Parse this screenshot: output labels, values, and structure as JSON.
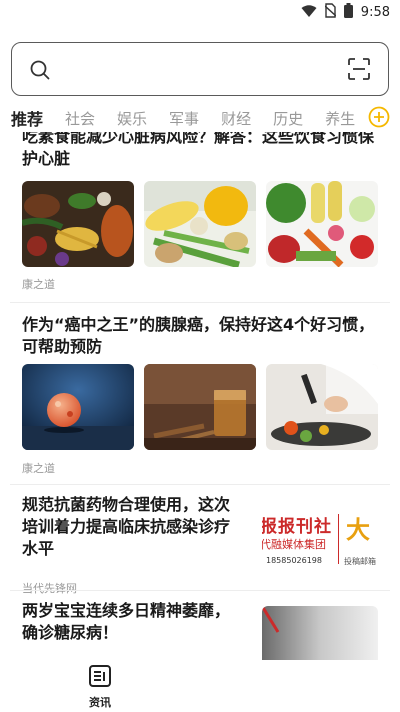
{
  "status_bar": {
    "time": "9:58",
    "icons": [
      "wifi-icon",
      "no-sim-icon",
      "battery-icon"
    ]
  },
  "search": {
    "placeholder": "",
    "search_icon": "search-icon",
    "scan_icon": "scan-icon"
  },
  "tabs": [
    {
      "label": "推荐",
      "active": true
    },
    {
      "label": "社会"
    },
    {
      "label": "娱乐"
    },
    {
      "label": "军事"
    },
    {
      "label": "财经"
    },
    {
      "label": "历史"
    },
    {
      "label": "养生"
    }
  ],
  "add_tab_icon": "plus-circle-icon",
  "accent_color": "#f5b800",
  "feed": {
    "articles": [
      {
        "title": "吃素食能减少心脏病风险？解答：这些饮食习惯保护心脏",
        "source": "康之道",
        "images": [
          "vegetables-table-image",
          "vegetables-corn-image",
          "vegetables-crate-image"
        ]
      },
      {
        "title": "作为“癌中之王”的胰腺癌，保持好这4个好习惯，可帮助预防",
        "source": "康之道",
        "images": [
          "cell-image",
          "tea-image",
          "cooking-image"
        ]
      },
      {
        "title": "规范抗菌药物合理使用，这次培训着力提高临床抗感染诊疗水平",
        "source": "当代先锋网",
        "thumb_text_line1": "报报刊社",
        "thumb_text_line2": "代融媒体集团",
        "thumb_text_phone": "18585026198",
        "thumb_text_big": "大",
        "thumb_text_small": "投稿邮箱"
      },
      {
        "title": "两岁宝宝连续多日精神萎靡，确诊糖尿病！"
      }
    ]
  },
  "bottom_nav": {
    "label": "资讯",
    "icon": "news-icon"
  }
}
